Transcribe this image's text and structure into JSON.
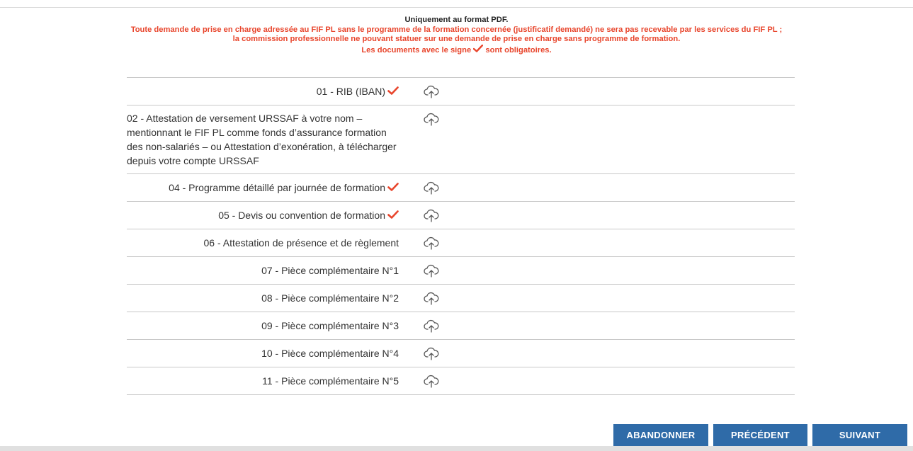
{
  "notice": {
    "format_line": "Uniquement au format PDF.",
    "warning_line_1": "Toute demande de prise en charge adressée au FIF PL sans le programme de la formation concernée (justificatif demandé) ne sera pas recevable par les services du FIF PL ;",
    "warning_line_2": "la commission professionnelle ne pouvant statuer sur une demande de prise en charge sans programme de formation.",
    "mandatory_prefix": "Les documents avec le signe",
    "mandatory_suffix": "sont obligatoires.",
    "check_icon": "check-mark-icon",
    "warning_color": "#e8452c"
  },
  "documents": [
    {
      "label": "01 - RIB (IBAN)",
      "required": true,
      "upload_icon": "cloud-upload-icon"
    },
    {
      "label": "02 - Attestation de versement URSSAF à votre nom – mentionnant le FIF PL comme fonds d’assurance formation des non-salariés – ou Attestation d’exonération, à télécharger depuis votre compte URSSAF",
      "required": false,
      "upload_icon": "cloud-upload-icon"
    },
    {
      "label": "04 - Programme détaillé par journée de formation",
      "required": true,
      "upload_icon": "cloud-upload-icon"
    },
    {
      "label": "05 - Devis ou convention de formation",
      "required": true,
      "upload_icon": "cloud-upload-icon"
    },
    {
      "label": "06 - Attestation de présence et de règlement",
      "required": false,
      "upload_icon": "cloud-upload-icon"
    },
    {
      "label": "07 - Pièce complémentaire N°1",
      "required": false,
      "upload_icon": "cloud-upload-icon"
    },
    {
      "label": "08 - Pièce complémentaire N°2",
      "required": false,
      "upload_icon": "cloud-upload-icon"
    },
    {
      "label": "09 - Pièce complémentaire N°3",
      "required": false,
      "upload_icon": "cloud-upload-icon"
    },
    {
      "label": "10 - Pièce complémentaire N°4",
      "required": false,
      "upload_icon": "cloud-upload-icon"
    },
    {
      "label": "11 - Pièce complémentaire N°5",
      "required": false,
      "upload_icon": "cloud-upload-icon"
    }
  ],
  "buttons": {
    "abandon": "ABANDONNER",
    "previous": "PRÉCÉDENT",
    "next": "SUIVANT",
    "color": "#2f6ba8"
  }
}
